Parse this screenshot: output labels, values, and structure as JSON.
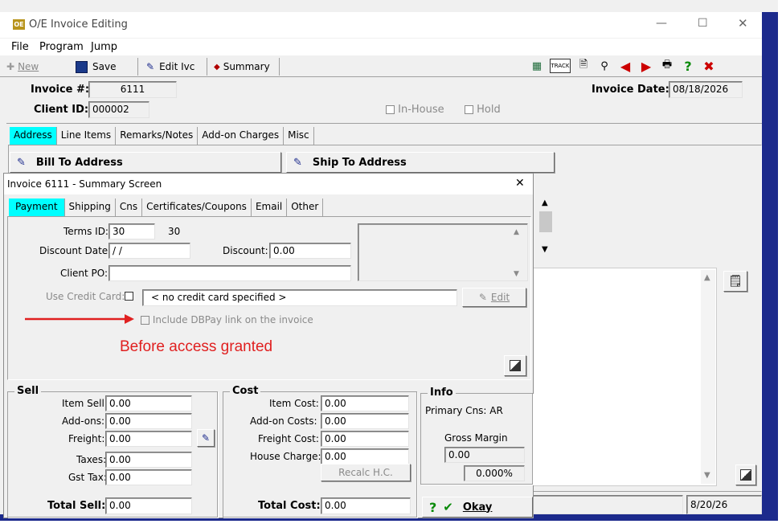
{
  "window": {
    "title": "O/E Invoice Editing",
    "app_icon": "oe-app-icon"
  },
  "menu": {
    "items": [
      "File",
      "Program",
      "Jump"
    ]
  },
  "toolbar": {
    "new_label": "New",
    "save_label": "Save",
    "edit_ivc_label": "Edit Ivc",
    "summary_label": "Summary",
    "right_icons": [
      "calculator-icon",
      "barcode-track-icon",
      "document-icon",
      "search-icon",
      "left-arrow-icon",
      "right-arrow-icon",
      "print-icon",
      "help-icon",
      "close-icon"
    ]
  },
  "invoice": {
    "invoice_no_label": "Invoice #:",
    "invoice_no": "6111",
    "client_id_label": "Client ID:",
    "client_id": "000002",
    "in_house_label": "In-House",
    "hold_label": "Hold",
    "invoice_date_label": "Invoice Date:",
    "invoice_date": "08/18/2026"
  },
  "main_tabs": [
    "Address",
    "Line Items",
    "Remarks/Notes",
    "Add-on Charges",
    "Misc"
  ],
  "address": {
    "bill_to_label": "Bill To Address",
    "ship_to_label": "Ship To Address"
  },
  "footer_date": "8/20/26",
  "summary": {
    "title": "Invoice 6111 - Summary Screen",
    "tabs": [
      "Payment",
      "Shipping",
      "Cns",
      "Certificates/Coupons",
      "Email",
      "Other"
    ],
    "terms_id_label": "Terms ID:",
    "terms_id": "30",
    "terms_desc": "30",
    "discount_date_label": "Discount Date:",
    "discount_date": " / /",
    "discount_label": "Discount:",
    "discount": "0.00",
    "client_po_label": "Client PO:",
    "client_po": "",
    "use_credit_card_label": "Use Credit Card:",
    "credit_card_value": "< no credit card specified >",
    "edit_label": "Edit",
    "dbpay_label": "Include DBPay link on the invoice",
    "annotation": "Before access granted",
    "sell": {
      "title": "Sell",
      "item_sell_label": "Item Sell:",
      "item_sell": "0.00",
      "addons_label": "Add-ons:",
      "addons": "0.00",
      "freight_label": "Freight:",
      "freight": "0.00",
      "taxes_label": "Taxes:",
      "taxes": "0.00",
      "gst_label": "Gst Tax:",
      "gst": "0.00",
      "total_label": "Total Sell:",
      "total": "0.00"
    },
    "cost": {
      "title": "Cost",
      "item_cost_label": "Item Cost:",
      "item_cost": "0.00",
      "addon_costs_label": "Add-on Costs:",
      "addon_costs": "0.00",
      "freight_cost_label": "Freight Cost:",
      "freight_cost": "0.00",
      "house_charge_label": "House Charge:",
      "house_charge": "0.00",
      "recalc_label": "Recalc H.C.",
      "total_label": "Total Cost:",
      "total": "0.00"
    },
    "info": {
      "title": "Info",
      "primary_cns": "Primary Cns: AR",
      "gross_margin_label": "Gross Margin",
      "gross_margin": "0.00",
      "gross_margin_pct": "0.000%"
    },
    "okay_label": "Okay"
  },
  "colors": {
    "accent_tab": "#00ffff",
    "annotation_red": "#e02020",
    "window_edge": "#1c2a8c"
  }
}
